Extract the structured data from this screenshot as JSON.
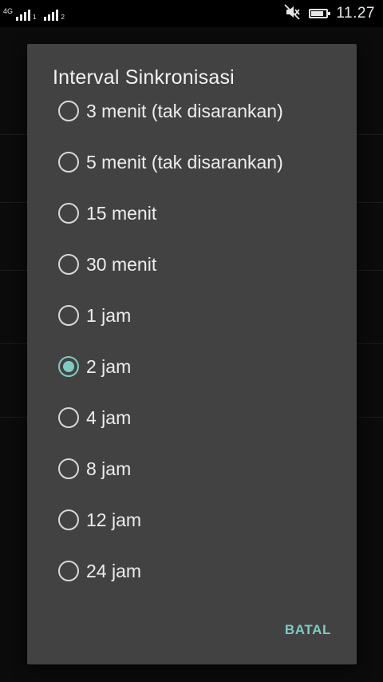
{
  "status_bar": {
    "network_label": "4G",
    "sim1_sub": "1",
    "sim2_sub": "2",
    "time": "11.27",
    "battery_level": 0.85,
    "icons": [
      "signal-sim1-icon",
      "signal-sim2-icon",
      "mute-icon",
      "battery-icon"
    ]
  },
  "dialog": {
    "title": "Interval Sinkronisasi",
    "options": [
      {
        "label": "3 menit (tak disarankan)",
        "selected": false
      },
      {
        "label": "5 menit (tak disarankan)",
        "selected": false
      },
      {
        "label": "15 menit",
        "selected": false
      },
      {
        "label": "30 menit",
        "selected": false
      },
      {
        "label": "1 jam",
        "selected": false
      },
      {
        "label": "2 jam",
        "selected": true
      },
      {
        "label": "4 jam",
        "selected": false
      },
      {
        "label": "8 jam",
        "selected": false
      },
      {
        "label": "12 jam",
        "selected": false
      },
      {
        "label": "24 jam",
        "selected": false
      }
    ],
    "cancel_label": "BATAL"
  },
  "colors": {
    "accent": "#7ecbc3",
    "dialog_bg": "#424242",
    "screen_bg": "#0b0b0b"
  }
}
